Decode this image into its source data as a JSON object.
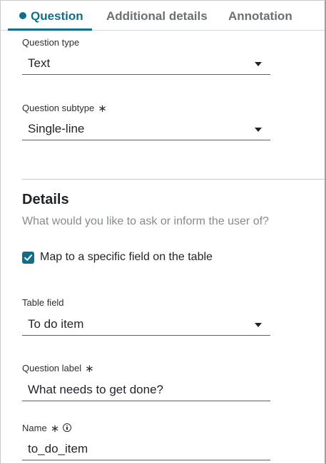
{
  "tabs": [
    {
      "label": "Question",
      "active": true
    },
    {
      "label": "Additional details",
      "active": false
    },
    {
      "label": "Annotation",
      "active": false
    }
  ],
  "question_type": {
    "label": "Question type",
    "value": "Text"
  },
  "question_subtype": {
    "label": "Question subtype",
    "required_mark": "∗",
    "value": "Single-line"
  },
  "details": {
    "heading": "Details",
    "subtext": "What would you like to ask or inform the user of?"
  },
  "map_field": {
    "label": "Map to a specific field on the table",
    "checked": true
  },
  "table_field": {
    "label": "Table field",
    "value": "To do item"
  },
  "question_label": {
    "label": "Question label",
    "required_mark": "∗",
    "value": "What needs to get done?"
  },
  "name": {
    "label": "Name",
    "required_mark": "∗",
    "value": "to_do_item"
  },
  "colors": {
    "accent": "#0f6f8a",
    "muted_text": "#868b90",
    "tab_inactive": "#6b7075"
  }
}
